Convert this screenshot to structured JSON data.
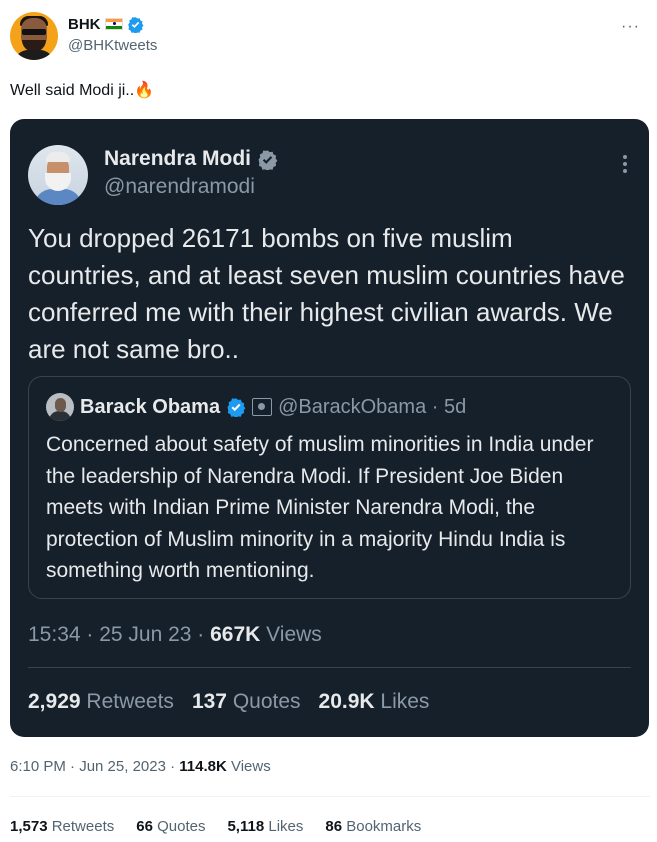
{
  "author": {
    "name": "BHK",
    "handle": "@BHKtweets",
    "flag": "india-flag"
  },
  "more_label": "···",
  "tweet_text": "Well said Modi ji..",
  "tweet_emoji": "🔥",
  "embedded": {
    "name": "Narendra Modi",
    "handle": "@narendramodi",
    "text": "You dropped 26171 bombs on five muslim countries, and at least seven muslim countries have conferred me with their highest civilian awards. We are not same bro..",
    "quote": {
      "name": "Barack Obama",
      "handle_time": "@BarackObama · 5d",
      "text": "Concerned about safety of muslim minorities in India under the leadership of Narendra Modi. If President Joe Biden meets with Indian Prime Minister Narendra Modi, the protection of Muslim minority in a majority Hindu India is something worth mentioning."
    },
    "meta_time": "15:34 · 25 Jun 23 · ",
    "meta_views_count": "667K",
    "meta_views_label": " Views",
    "stats": {
      "retweets_count": "2,929",
      "retweets_label": " Retweets",
      "quotes_count": "137",
      "quotes_label": " Quotes",
      "likes_count": "20.9K",
      "likes_label": " Likes"
    }
  },
  "timestamp": "6:10 PM · Jun 25, 2023 · ",
  "views_count": "114.8K",
  "views_label": " Views",
  "stats": {
    "retweets_count": "1,573",
    "retweets_label": " Retweets",
    "quotes_count": "66",
    "quotes_label": " Quotes",
    "likes_count": "5,118",
    "likes_label": " Likes",
    "bookmarks_count": "86",
    "bookmarks_label": " Bookmarks"
  },
  "colors": {
    "verified": "#1d9bf0",
    "embed_bg": "#15202b"
  }
}
